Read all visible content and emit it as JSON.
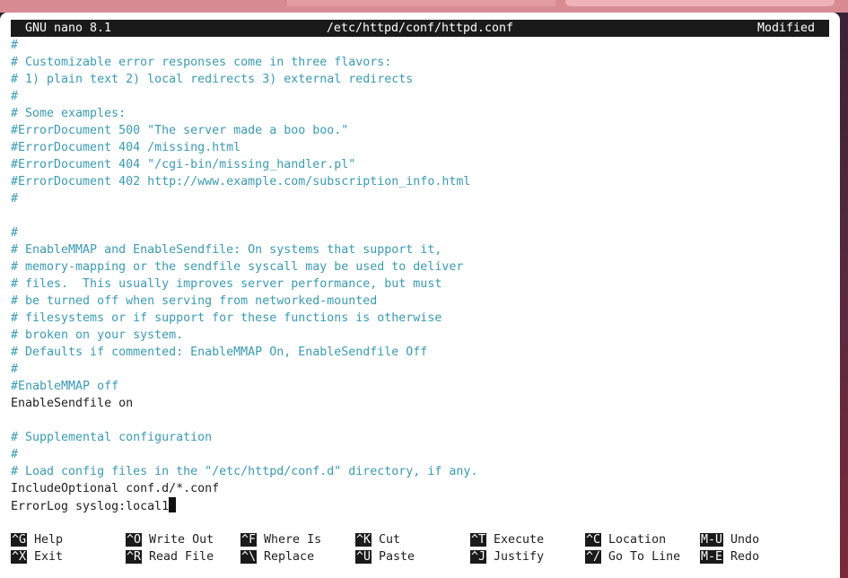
{
  "titlebar": {
    "app": "GNU nano 8.1",
    "file": "/etc/httpd/conf/httpd.conf",
    "status": "Modified"
  },
  "lines": [
    {
      "text": "#",
      "kind": "comment"
    },
    {
      "text": "# Customizable error responses come in three flavors:",
      "kind": "comment"
    },
    {
      "text": "# 1) plain text 2) local redirects 3) external redirects",
      "kind": "comment"
    },
    {
      "text": "#",
      "kind": "comment"
    },
    {
      "text": "# Some examples:",
      "kind": "comment"
    },
    {
      "text": "#ErrorDocument 500 \"The server made a boo boo.\"",
      "kind": "comment"
    },
    {
      "text": "#ErrorDocument 404 /missing.html",
      "kind": "comment"
    },
    {
      "text": "#ErrorDocument 404 \"/cgi-bin/missing_handler.pl\"",
      "kind": "comment"
    },
    {
      "text": "#ErrorDocument 402 http://www.example.com/subscription_info.html",
      "kind": "comment"
    },
    {
      "text": "#",
      "kind": "comment"
    },
    {
      "text": "",
      "kind": "plain"
    },
    {
      "text": "#",
      "kind": "comment"
    },
    {
      "text": "# EnableMMAP and EnableSendfile: On systems that support it,",
      "kind": "comment"
    },
    {
      "text": "# memory-mapping or the sendfile syscall may be used to deliver",
      "kind": "comment"
    },
    {
      "text": "# files.  This usually improves server performance, but must",
      "kind": "comment"
    },
    {
      "text": "# be turned off when serving from networked-mounted",
      "kind": "comment"
    },
    {
      "text": "# filesystems or if support for these functions is otherwise",
      "kind": "comment"
    },
    {
      "text": "# broken on your system.",
      "kind": "comment"
    },
    {
      "text": "# Defaults if commented: EnableMMAP On, EnableSendfile Off",
      "kind": "comment"
    },
    {
      "text": "#",
      "kind": "comment"
    },
    {
      "text": "#EnableMMAP off",
      "kind": "comment"
    },
    {
      "text": "EnableSendfile on",
      "kind": "plain"
    },
    {
      "text": "",
      "kind": "plain"
    },
    {
      "text": "# Supplemental configuration",
      "kind": "comment"
    },
    {
      "text": "#",
      "kind": "comment"
    },
    {
      "text": "# Load config files in the \"/etc/httpd/conf.d\" directory, if any.",
      "kind": "comment"
    },
    {
      "text": "IncludeOptional conf.d/*.conf",
      "kind": "plain"
    },
    {
      "text": "ErrorLog syslog:local1",
      "kind": "plain",
      "cursor": true
    }
  ],
  "shortcuts": [
    [
      {
        "key": "^G",
        "label": "Help"
      },
      {
        "key": "^O",
        "label": "Write Out"
      },
      {
        "key": "^F",
        "label": "Where Is"
      },
      {
        "key": "^K",
        "label": "Cut"
      },
      {
        "key": "^T",
        "label": "Execute"
      },
      {
        "key": "^C",
        "label": "Location"
      },
      {
        "key": "M-U",
        "label": "Undo"
      }
    ],
    [
      {
        "key": "^X",
        "label": "Exit"
      },
      {
        "key": "^R",
        "label": "Read File"
      },
      {
        "key": "^\\",
        "label": "Replace"
      },
      {
        "key": "^U",
        "label": "Paste"
      },
      {
        "key": "^J",
        "label": "Justify"
      },
      {
        "key": "^/",
        "label": "Go To Line"
      },
      {
        "key": "M-E",
        "label": "Redo"
      }
    ]
  ],
  "colors": {
    "comment": "#3a9bb3",
    "plain": "#1e1e1e",
    "bar": "#1a1a1a"
  }
}
